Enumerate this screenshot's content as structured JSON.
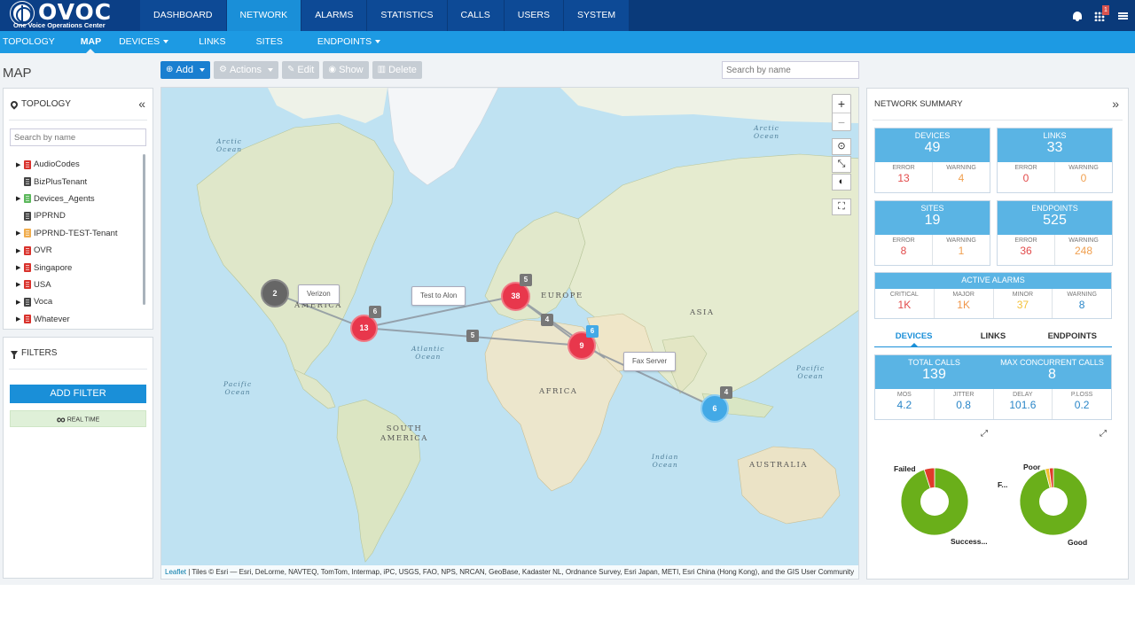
{
  "app": {
    "logo_text": "OVOC",
    "logo_subtitle": "One Voice Operations Center",
    "notification_count": "1"
  },
  "main_nav": [
    {
      "label": "DASHBOARD",
      "active": false
    },
    {
      "label": "NETWORK",
      "active": true
    },
    {
      "label": "ALARMS",
      "active": false
    },
    {
      "label": "STATISTICS",
      "active": false
    },
    {
      "label": "CALLS",
      "active": false
    },
    {
      "label": "USERS",
      "active": false
    },
    {
      "label": "SYSTEM",
      "active": false
    }
  ],
  "sub_nav": [
    {
      "label": "TOPOLOGY",
      "dropdown": false,
      "active": false
    },
    {
      "label": "MAP",
      "dropdown": false,
      "active": true
    },
    {
      "label": "DEVICES",
      "dropdown": true,
      "active": false
    },
    {
      "label": "LINKS",
      "dropdown": false,
      "active": false
    },
    {
      "label": "SITES",
      "dropdown": false,
      "active": false
    },
    {
      "label": "ENDPOINTS",
      "dropdown": true,
      "active": false
    }
  ],
  "page": {
    "title": "MAP"
  },
  "toolbar": {
    "add": "Add",
    "actions": "Actions",
    "edit": "Edit",
    "show": "Show",
    "delete": "Delete",
    "search_placeholder": "Search by name"
  },
  "topology": {
    "title": "TOPOLOGY",
    "search_placeholder": "Search by name",
    "items": [
      {
        "label": "AudioCodes",
        "expandable": true,
        "color": "#d9322c"
      },
      {
        "label": "BizPlusTenant",
        "expandable": false,
        "color": "#444444"
      },
      {
        "label": "Devices_Agents",
        "expandable": true,
        "color": "#5cb85c"
      },
      {
        "label": "IPPRND",
        "expandable": false,
        "color": "#444444"
      },
      {
        "label": "IPPRND-TEST-Tenant",
        "expandable": true,
        "color": "#f0ad4e"
      },
      {
        "label": "OVR",
        "expandable": true,
        "color": "#d9322c"
      },
      {
        "label": "Singapore",
        "expandable": true,
        "color": "#d9322c"
      },
      {
        "label": "USA",
        "expandable": true,
        "color": "#d9322c"
      },
      {
        "label": "Voca",
        "expandable": true,
        "color": "#444444"
      },
      {
        "label": "Whatever",
        "expandable": true,
        "color": "#d9322c"
      }
    ]
  },
  "filters": {
    "title": "FILTERS",
    "add_filter": "ADD FILTER",
    "real_time": "REAL TIME"
  },
  "map": {
    "zoom_in": "+",
    "zoom_out": "−",
    "labels": {
      "arctic_left": "Arctic\nOcean",
      "arctic_right": "Arctic\nOcean",
      "pacific_left": "Pacific\nOcean",
      "pacific_right": "Pacific\nOcean",
      "atlantic": "Atlantic\nOcean",
      "indian": "Indian\nOcean",
      "north_america": "AMERICA",
      "europe": "EUROPE",
      "asia": "ASIA",
      "africa": "AFRICA",
      "south_america": "SOUTH\nAMERICA",
      "australia": "AUSTRALIA"
    },
    "clusters": [
      {
        "id": "na-west",
        "count": "2",
        "type": "gray"
      },
      {
        "id": "na-east",
        "count": "13",
        "type": "red"
      },
      {
        "id": "europe",
        "count": "38",
        "type": "red"
      },
      {
        "id": "middle-east",
        "count": "9",
        "type": "red"
      },
      {
        "id": "indonesia",
        "count": "6",
        "type": "blue"
      }
    ],
    "link_counts": [
      {
        "id": "na-east-chip",
        "count": "6",
        "type": "gray"
      },
      {
        "id": "atlantic-chip",
        "count": "5",
        "type": "gray"
      },
      {
        "id": "europe-chip",
        "count": "5",
        "type": "gray"
      },
      {
        "id": "mediterranean-chip",
        "count": "4",
        "type": "gray"
      },
      {
        "id": "middle-east-chip",
        "count": "6",
        "type": "blue"
      },
      {
        "id": "indonesia-chip",
        "count": "4",
        "type": "gray"
      }
    ],
    "link_labels": {
      "verizon": "Verizon",
      "test_to_alon": "Test to Alon",
      "fax_server": "Fax Server"
    },
    "attribution_leaflet": "Leaflet",
    "attribution_text": " | Tiles © Esri — Esri, DeLorme, NAVTEQ, TomTom, Intermap, iPC, USGS, FAO, NPS, NRCAN, GeoBase, Kadaster NL, Ordnance Survey, Esri Japan, METI, Esri China (Hong Kong), and the GIS User Community"
  },
  "summary": {
    "title": "NETWORK SUMMARY",
    "devices": {
      "label": "DEVICES",
      "value": "49",
      "error_label": "ERROR",
      "error": "13",
      "warning_label": "WARNING",
      "warning": "4"
    },
    "links": {
      "label": "LINKS",
      "value": "33",
      "error_label": "ERROR",
      "error": "0",
      "warning_label": "WARNING",
      "warning": "0"
    },
    "sites": {
      "label": "SITES",
      "value": "19",
      "error_label": "ERROR",
      "error": "8",
      "warning_label": "WARNING",
      "warning": "1"
    },
    "endpoints": {
      "label": "ENDPOINTS",
      "value": "525",
      "error_label": "ERROR",
      "error": "36",
      "warning_label": "WARNING",
      "warning": "248"
    },
    "active_alarms": {
      "label": "ACTIVE ALARMS",
      "critical_label": "CRITICAL",
      "critical": "1K",
      "major_label": "MAJOR",
      "major": "1K",
      "minor_label": "MINOR",
      "minor": "37",
      "warning_label": "WARNING",
      "warning": "8"
    },
    "tabs": [
      {
        "label": "DEVICES",
        "active": true
      },
      {
        "label": "LINKS",
        "active": false
      },
      {
        "label": "ENDPOINTS",
        "active": false
      }
    ],
    "calls": {
      "total_label": "TOTAL CALLS",
      "total": "139",
      "max_label": "MAX CONCURRENT CALLS",
      "max": "8",
      "mos_label": "MOS",
      "mos": "4.2",
      "jitter_label": "JITTER",
      "jitter": "0.8",
      "delay_label": "DELAY",
      "delay": "101.6",
      "ploss_label": "P.LOSS",
      "ploss": "0.2"
    },
    "pie_success": {
      "labels": {
        "failed": "Failed",
        "success": "Success..."
      },
      "failed_fraction": 0.05,
      "colors": {
        "success": "#6aaf1a",
        "failed": "#e03a2a"
      }
    },
    "pie_quality": {
      "labels": {
        "poor": "Poor",
        "fair": "F...",
        "good": "Good"
      },
      "poor_fraction": 0.02,
      "fair_fraction": 0.02,
      "colors": {
        "good": "#6aaf1a",
        "poor": "#e03a2a",
        "fair": "#f0c030"
      }
    }
  }
}
